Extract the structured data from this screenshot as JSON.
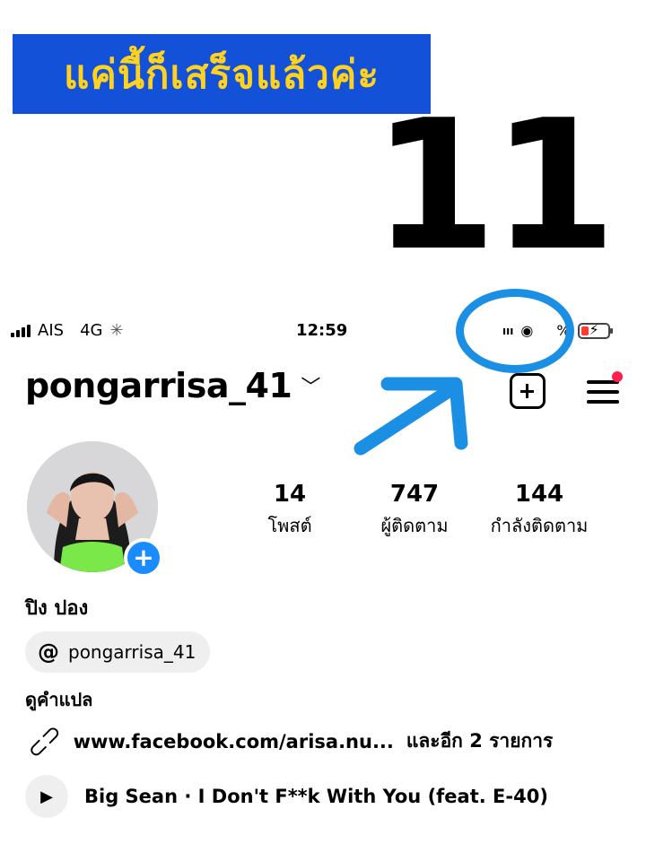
{
  "tutorial": {
    "banner_text": "แค่นี้ก็เสร็จแล้วค่ะ",
    "step_number": "11"
  },
  "status_bar": {
    "carrier": "AIS",
    "network": "4G",
    "time": "12:59",
    "battery_text": "%",
    "icons": [
      "signal-bars-icon",
      "loading-spinner-icon",
      "ais-wifi-icon",
      "rotation-lock-icon",
      "battery-charging-icon"
    ]
  },
  "profile": {
    "username": "pongarrisa_41",
    "display_name": "ปิง ปอง",
    "threads_handle": "pongarrisa_41",
    "translate_label": "ดูคำแปล",
    "link_text": "www.facebook.com/arisa.nu...",
    "link_more": "และอีก 2 รายการ",
    "music_text": "Big Sean · I Don't F**k With You (feat. E-40)"
  },
  "stats": {
    "posts": {
      "value": "14",
      "label": "โพสต์"
    },
    "followers": {
      "value": "747",
      "label": "ผู้ติดตาม"
    },
    "following": {
      "value": "144",
      "label": "กำลังติดตาม"
    }
  },
  "colors": {
    "banner_bg": "#1351d8",
    "banner_text": "#ffd21f",
    "annotation_blue": "#1a8fe3",
    "avatar_add": "#1b8cff",
    "notification_dot": "#ff1f4b",
    "pill_bg": "#efefef"
  }
}
